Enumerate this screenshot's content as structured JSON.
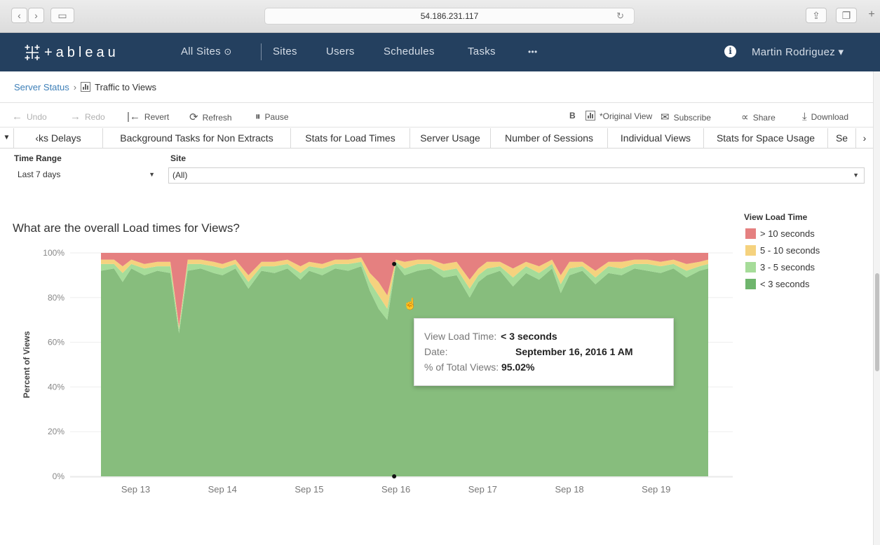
{
  "browser": {
    "address": "54.186.231.117"
  },
  "nav": {
    "logo_text": "+ableau",
    "all_sites": "All Sites",
    "sites": "Sites",
    "users": "Users",
    "schedules": "Schedules",
    "tasks": "Tasks",
    "more": "•••",
    "user": "Martin Rodriguez ▾"
  },
  "breadcrumb": {
    "parent": "Server Status",
    "separator": "›",
    "current": "Traffic to Views"
  },
  "toolbar": {
    "undo": "Undo",
    "redo": "Redo",
    "revert": "Revert",
    "refresh": "Refresh",
    "pause": "Pause",
    "b_label": "B",
    "original_view": "*Original View",
    "subscribe": "Subscribe",
    "share": "Share",
    "download": "Download"
  },
  "tabs": [
    {
      "label": "‹ks Delays"
    },
    {
      "label": "Background Tasks for Non Extracts"
    },
    {
      "label": "Stats for Load Times"
    },
    {
      "label": "Server Usage"
    },
    {
      "label": "Number of Sessions"
    },
    {
      "label": "Individual Views"
    },
    {
      "label": "Stats for Space Usage"
    },
    {
      "label": "Se"
    }
  ],
  "filters": {
    "time_range_label": "Time Range",
    "time_range_value": "Last 7 days",
    "site_label": "Site",
    "site_value": "(All)"
  },
  "chart_title": "What are the overall Load times for Views?",
  "legend": {
    "title": "View Load Time",
    "items": [
      {
        "label": "> 10 seconds",
        "color": "#e58080"
      },
      {
        "label": "5 - 10 seconds",
        "color": "#f5d27e"
      },
      {
        "label": "3 - 5 seconds",
        "color": "#a6dc99"
      },
      {
        "label": "< 3 seconds",
        "color": "#6fb56d"
      }
    ]
  },
  "tooltip": {
    "k1": "View Load Time:",
    "v1": "< 3 seconds",
    "k2": "Date:",
    "v2": "September 16, 2016 1 AM",
    "k3": "% of Total Views:",
    "v3": "95.02%"
  },
  "chart_data": {
    "type": "area",
    "stacked": "percent",
    "ylabel": "Percent of Views",
    "yticks": [
      "0%",
      "20%",
      "40%",
      "60%",
      "80%",
      "100%"
    ],
    "ylim": [
      0,
      100
    ],
    "xticks": [
      "Sep 13",
      "Sep 14",
      "Sep 15",
      "Sep 16",
      "Sep 17",
      "Sep 18",
      "Sep 19"
    ],
    "x_start_day": 12.6,
    "x_end_day": 19.6,
    "x": [
      12.6,
      12.75,
      12.85,
      12.95,
      13.1,
      13.25,
      13.4,
      13.5,
      13.6,
      13.75,
      13.9,
      14.0,
      14.15,
      14.3,
      14.45,
      14.6,
      14.75,
      14.9,
      15.0,
      15.15,
      15.3,
      15.45,
      15.6,
      15.7,
      15.8,
      15.9,
      16.0,
      16.1,
      16.25,
      16.4,
      16.55,
      16.7,
      16.85,
      16.95,
      17.05,
      17.2,
      17.35,
      17.5,
      17.65,
      17.8,
      17.9,
      18.0,
      18.15,
      18.3,
      18.45,
      18.6,
      18.75,
      18.9,
      19.05,
      19.2,
      19.35,
      19.5,
      19.6
    ],
    "series": [
      {
        "name": "< 3 seconds",
        "color": "#87bd7d",
        "values": [
          92,
          93,
          87,
          93,
          90,
          92,
          91,
          64,
          92,
          93,
          91,
          90,
          93,
          84,
          92,
          91,
          93,
          88,
          92,
          90,
          93,
          92,
          94,
          83,
          75,
          70,
          95,
          90,
          92,
          93,
          89,
          90,
          80,
          87,
          90,
          92,
          85,
          91,
          88,
          93,
          82,
          90,
          92,
          86,
          91,
          90,
          93,
          92,
          91,
          93,
          89,
          92,
          93
        ]
      },
      {
        "name": "3 - 5 seconds",
        "color": "#a6dc99",
        "values": [
          3,
          2,
          4,
          2,
          3,
          2,
          3,
          2,
          3,
          2,
          3,
          3,
          2,
          3,
          2,
          3,
          2,
          3,
          2,
          3,
          2,
          3,
          2,
          4,
          6,
          5,
          1,
          3,
          3,
          2,
          3,
          3,
          4,
          3,
          3,
          2,
          4,
          3,
          3,
          2,
          4,
          3,
          2,
          3,
          3,
          3,
          2,
          3,
          3,
          2,
          3,
          2,
          2
        ]
      },
      {
        "name": "5 - 10 seconds",
        "color": "#f5d27e",
        "values": [
          2,
          2,
          3,
          2,
          2,
          2,
          2,
          1,
          2,
          2,
          2,
          2,
          2,
          3,
          2,
          2,
          2,
          3,
          2,
          2,
          2,
          2,
          2,
          4,
          6,
          6,
          1,
          3,
          2,
          2,
          3,
          3,
          4,
          3,
          3,
          2,
          4,
          2,
          3,
          2,
          4,
          3,
          2,
          3,
          2,
          3,
          2,
          2,
          2,
          2,
          3,
          2,
          2
        ]
      },
      {
        "name": "> 10 seconds",
        "color": "#e58080",
        "values": [
          3,
          3,
          6,
          3,
          5,
          4,
          4,
          33,
          3,
          3,
          4,
          5,
          3,
          10,
          4,
          4,
          3,
          6,
          4,
          5,
          3,
          3,
          2,
          9,
          13,
          19,
          3,
          4,
          3,
          3,
          5,
          4,
          12,
          7,
          4,
          4,
          7,
          4,
          6,
          3,
          10,
          4,
          4,
          8,
          4,
          4,
          3,
          3,
          4,
          3,
          5,
          4,
          3
        ]
      }
    ]
  }
}
